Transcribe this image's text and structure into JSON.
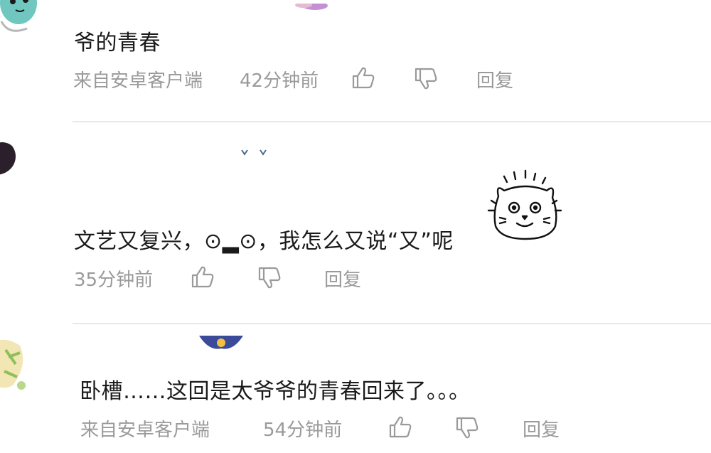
{
  "comments": [
    {
      "text": "爷的青春",
      "source": "来自安卓客户端",
      "time": "42分钟前",
      "reply_label": "回复",
      "like_icon": "thumbs-up-icon",
      "dislike_icon": "thumbs-down-icon"
    },
    {
      "text": "文艺又复兴，⊙▂⊙，我怎么又说“又”呢",
      "time": "35分钟前",
      "reply_label": "回复",
      "sticker": "shocked-cat-sticker",
      "like_icon": "thumbs-up-icon",
      "dislike_icon": "thumbs-down-icon"
    },
    {
      "text": "卧槽……这回是太爷爷的青春回来了。。。",
      "source": "来自安卓客户端",
      "time": "54分钟前",
      "reply_label": "回复",
      "like_icon": "thumbs-up-icon",
      "dislike_icon": "thumbs-down-icon"
    }
  ],
  "colors": {
    "text": "#1a1a1a",
    "meta": "#9a9a9a",
    "divider": "#e8e8e8"
  }
}
